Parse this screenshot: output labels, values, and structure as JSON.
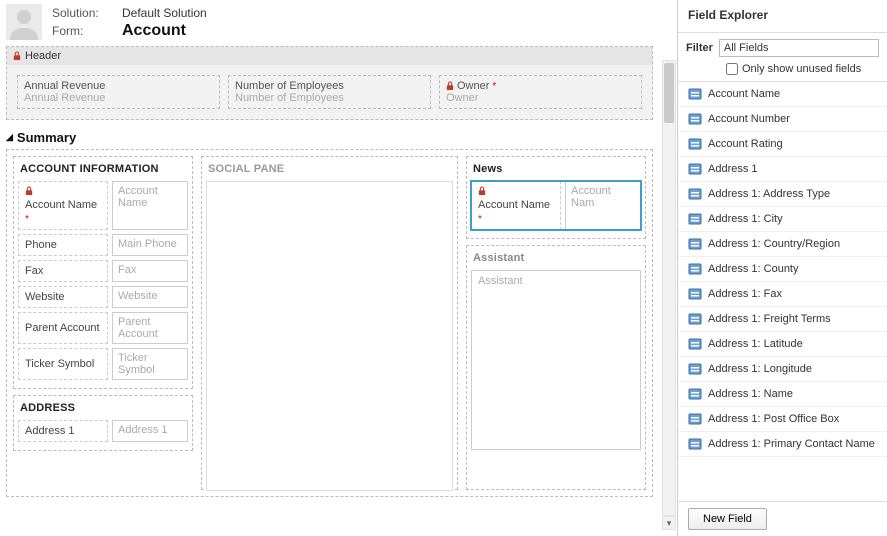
{
  "topHeader": {
    "solutionLabel": "Solution:",
    "solutionName": "Default Solution",
    "formLabel": "Form:",
    "formName": "Account"
  },
  "headerBlock": {
    "title": "Header",
    "fields": [
      {
        "label": "Annual Revenue",
        "placeholder": "Annual Revenue",
        "locked": false,
        "required": false
      },
      {
        "label": "Number of Employees",
        "placeholder": "Number of Employees",
        "locked": false,
        "required": false
      },
      {
        "label": "Owner",
        "placeholder": "Owner",
        "locked": true,
        "required": true
      }
    ]
  },
  "tab": {
    "title": "Summary"
  },
  "accountInfoSection": {
    "title": "ACCOUNT INFORMATION",
    "rows": [
      {
        "label": "Account Name",
        "placeholder": "Account Name",
        "locked": true,
        "required": true
      },
      {
        "label": "Phone",
        "placeholder": "Main Phone",
        "locked": false,
        "required": false
      },
      {
        "label": "Fax",
        "placeholder": "Fax",
        "locked": false,
        "required": false
      },
      {
        "label": "Website",
        "placeholder": "Website",
        "locked": false,
        "required": false
      },
      {
        "label": "Parent Account",
        "placeholder": "Parent Account",
        "locked": false,
        "required": false
      },
      {
        "label": "Ticker Symbol",
        "placeholder": "Ticker Symbol",
        "locked": false,
        "required": false
      }
    ]
  },
  "addressSection": {
    "title": "ADDRESS",
    "rows": [
      {
        "label": "Address 1",
        "placeholder": "Address 1",
        "locked": false,
        "required": false
      }
    ]
  },
  "socialPane": {
    "title": "SOCIAL PANE"
  },
  "newsSection": {
    "title": "News",
    "row": {
      "label": "Account Name",
      "placeholder": "Account Nam",
      "locked": true,
      "required": true
    }
  },
  "assistantSection": {
    "title": "Assistant",
    "placeholder": "Assistant"
  },
  "explorer": {
    "title": "Field Explorer",
    "filterLabel": "Filter",
    "filterValue": "All Fields",
    "checkboxLabel": "Only show unused fields",
    "checkboxChecked": false,
    "items": [
      "Account Name",
      "Account Number",
      "Account Rating",
      "Address 1",
      "Address 1: Address Type",
      "Address 1: City",
      "Address 1: Country/Region",
      "Address 1: County",
      "Address 1: Fax",
      "Address 1: Freight Terms",
      "Address 1: Latitude",
      "Address 1: Longitude",
      "Address 1: Name",
      "Address 1: Post Office Box",
      "Address 1: Primary Contact Name"
    ],
    "newFieldLabel": "New Field"
  }
}
